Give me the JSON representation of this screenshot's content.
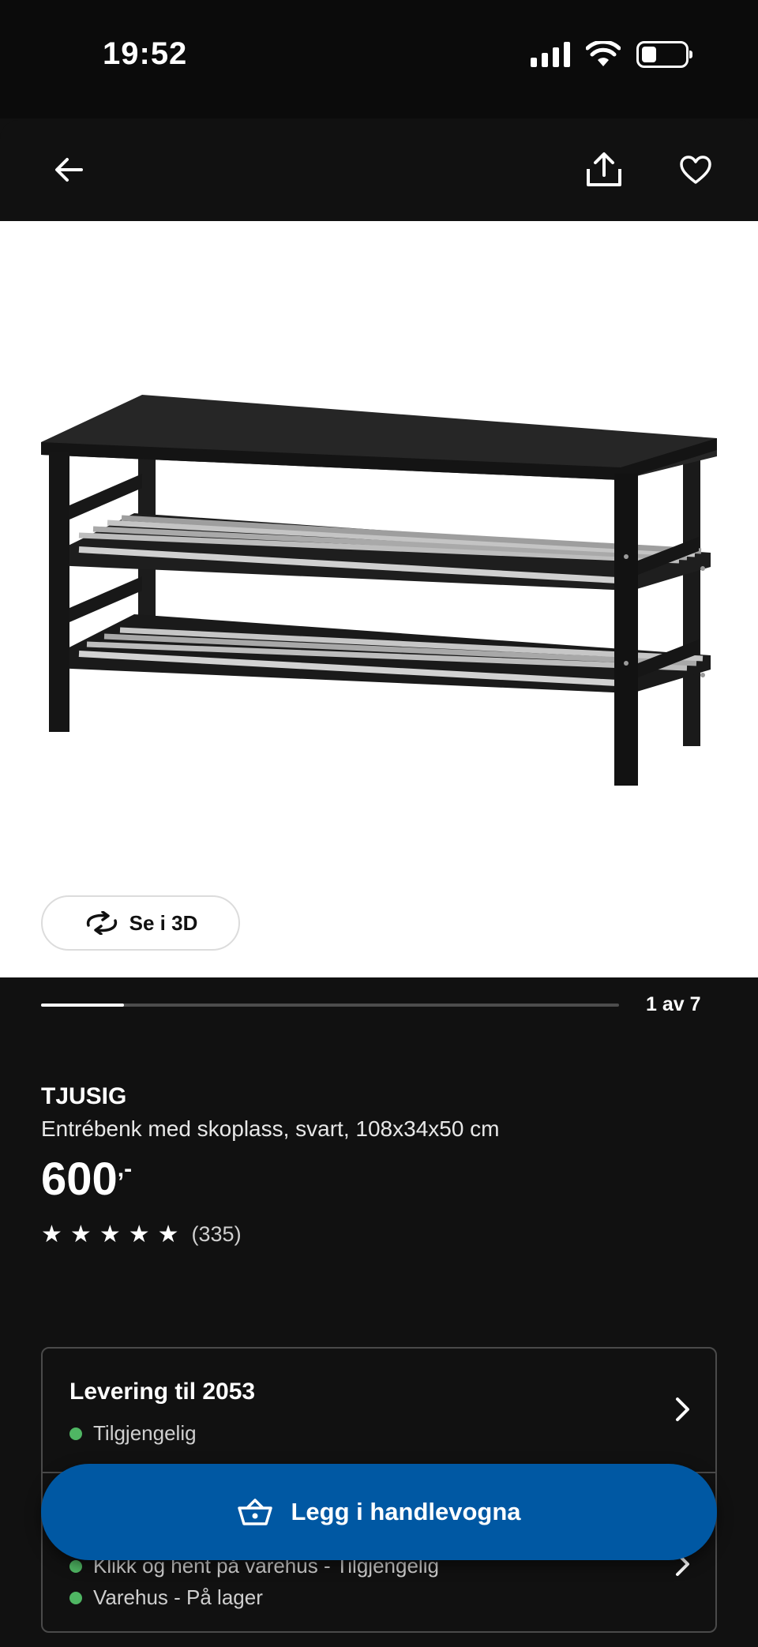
{
  "status_bar": {
    "time": "19:52"
  },
  "nav": {
    "back_icon": "arrow-left-icon",
    "share_icon": "share-icon",
    "favorite_icon": "heart-icon"
  },
  "gallery": {
    "view_3d_label": "Se i 3D",
    "counter": "1 av 7",
    "progress": 0.143
  },
  "product": {
    "name": "TJUSIG",
    "description": "Entrébenk med skoplass, svart, 108x34x50 cm",
    "price": "600",
    "price_suffix": ",-",
    "rating_stars": 5,
    "rating_count": "(335)"
  },
  "delivery": {
    "title": "Levering til 2053",
    "status": "Tilgjengelig",
    "pickup": "Klikk og hent på varehus - Tilgjengelig",
    "store": "Varehus - På lager"
  },
  "cart_button": {
    "label": "Legg i handlevogna"
  },
  "colors": {
    "accent": "#0058a3",
    "available": "#4fb663",
    "background": "#111111"
  }
}
